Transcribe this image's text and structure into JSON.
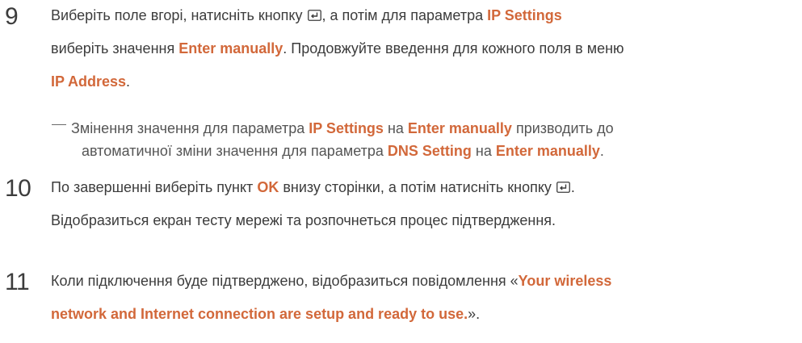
{
  "step9": {
    "number": "9",
    "l1_a": "Виберіть поле вгорі, натисніть кнопку ",
    "l1_b": ", а потім для параметра ",
    "l1_hl": "IP Settings",
    "l2_a": "виберіть значення ",
    "l2_hl": "Enter manually",
    "l2_b": ". Продовжуйте введення для кожного поля в меню",
    "l3_hl": "IP Address",
    "l3_b": "."
  },
  "note": {
    "l1_a": "Змінення значення для параметра ",
    "l1_hl1": "IP Settings",
    "l1_b": " на ",
    "l1_hl2": "Enter manually",
    "l1_c": " призводить до",
    "l2_a": "автоматичної зміни значення для параметра ",
    "l2_hl1": "DNS Setting",
    "l2_b": " на ",
    "l2_hl2": "Enter manually",
    "l2_c": "."
  },
  "step10": {
    "number": "10",
    "l1_a": "По завершенні виберіть пункт ",
    "l1_hl": "OK",
    "l1_b": " внизу сторінки, а потім натисніть кнопку ",
    "l1_c": ".",
    "l2": "Відобразиться екран тесту мережі та розпочнеться процес підтвердження."
  },
  "step11": {
    "number": "11",
    "l1_a": "Коли підключення буде підтверджено, відобразиться повідомлення «",
    "l1_hl": "Your wireless",
    "l2_hl": "network and Internet connection are setup and ready to use.",
    "l2_b": "»."
  },
  "icons": {
    "enter": "enter-key-icon"
  },
  "colors": {
    "highlight": "#d2683a",
    "text": "#3c3c3c"
  }
}
